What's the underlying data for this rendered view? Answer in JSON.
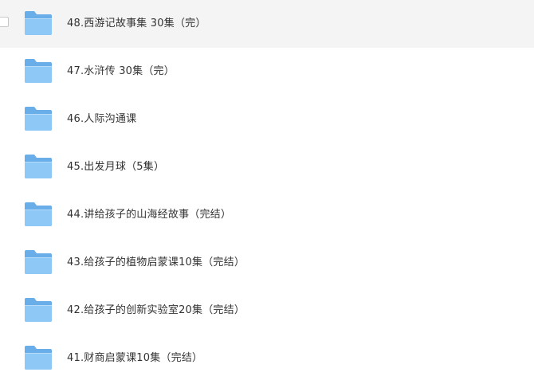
{
  "icons": {
    "folder": "folder-icon"
  },
  "colors": {
    "hover_row": "#f4f4f4",
    "folder_back": "#6aaee9",
    "folder_front": "#8ec8f6",
    "text": "#333333"
  },
  "files": [
    {
      "name": "48.西游记故事集 30集（完）",
      "hovered": true
    },
    {
      "name": "47.水浒传 30集（完）",
      "hovered": false
    },
    {
      "name": "46.人际沟通课",
      "hovered": false
    },
    {
      "name": "45.出发月球（5集）",
      "hovered": false
    },
    {
      "name": "44.讲给孩子的山海经故事（完结）",
      "hovered": false
    },
    {
      "name": "43.给孩子的植物启蒙课10集（完结）",
      "hovered": false
    },
    {
      "name": "42.给孩子的创新实验室20集（完结）",
      "hovered": false
    },
    {
      "name": "41.财商启蒙课10集（完结）",
      "hovered": false
    }
  ]
}
